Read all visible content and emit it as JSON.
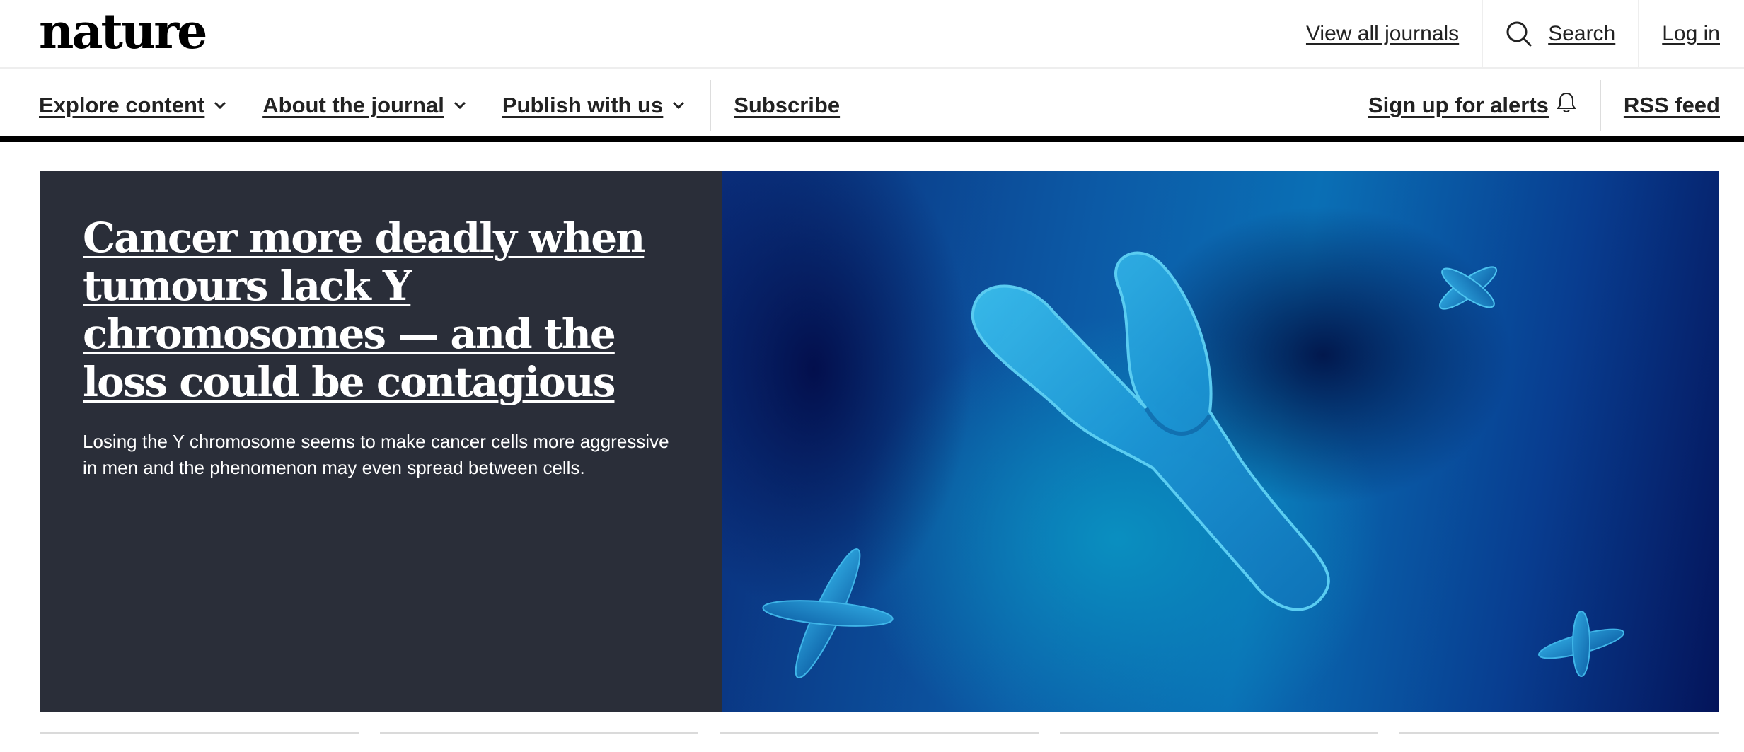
{
  "header": {
    "logo": "nature",
    "view_all_journals": "View all journals",
    "search": "Search",
    "login": "Log in"
  },
  "nav": {
    "items": [
      {
        "label": "Explore content"
      },
      {
        "label": "About the journal"
      },
      {
        "label": "Publish with us"
      }
    ],
    "subscribe": "Subscribe",
    "alerts": "Sign up for alerts",
    "rss": "RSS feed"
  },
  "hero": {
    "title": "Cancer more deadly when tumours lack Y chromosomes — and the loss could be contagious",
    "summary": "Losing the Y chromosome seems to make cancer cells more aggressive in men and the phenomenon may even spread between cells.",
    "image_icon": "y-chromosome-illustration"
  },
  "colors": {
    "hero_panel": "#2a2e39",
    "nav_rule": "#000000",
    "chromosome": "#1fa4dc"
  },
  "cards_count": 5
}
